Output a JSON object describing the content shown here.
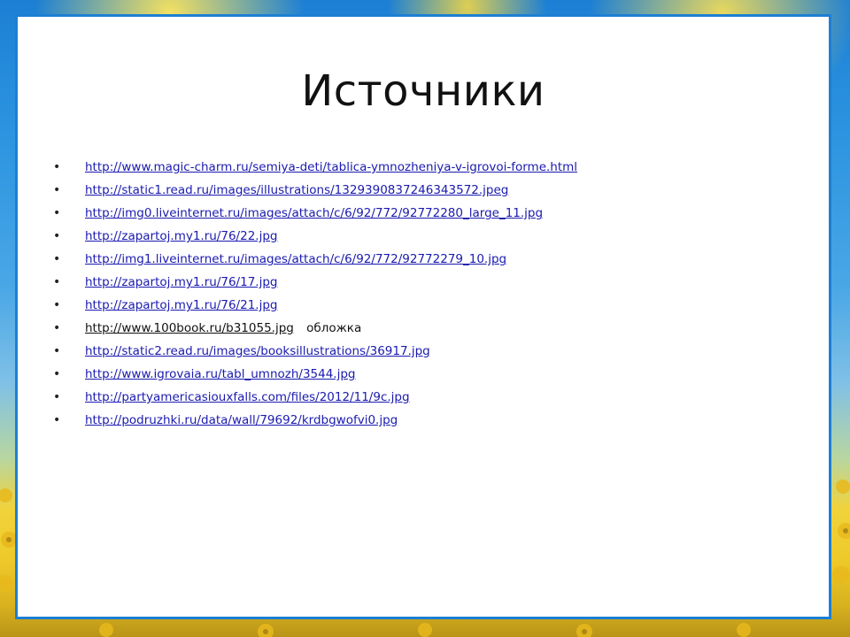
{
  "slide": {
    "title": "Источники",
    "sources": [
      {
        "url": "http://www.magic-charm.ru/semiya-deti/tablica-ymnozheniya-v-igrovoi-forme.html",
        "note": ""
      },
      {
        "url": "http://static1.read.ru/images/illustrations/1329390837246343572.jpeg",
        "note": ""
      },
      {
        "url": "http://img0.liveinternet.ru/images/attach/c/6/92/772/92772280_large_11.jpg",
        "note": ""
      },
      {
        "url": "http://zapartoj.my1.ru/76/22.jpg",
        "note": ""
      },
      {
        "url": "http://img1.liveinternet.ru/images/attach/c/6/92/772/92772279_10.jpg",
        "note": ""
      },
      {
        "url": "http://zapartoj.my1.ru/76/17.jpg",
        "note": ""
      },
      {
        "url": "http://zapartoj.my1.ru/76/21.jpg",
        "note": ""
      },
      {
        "url": "http://www.100book.ru/b31055.jpg",
        "note": "обложка"
      },
      {
        "url": "http://static2.read.ru/images/booksillustrations/36917.jpg",
        "note": ""
      },
      {
        "url": "http://www.igrovaia.ru/tabl_umnozh/3544.jpg",
        "note": ""
      },
      {
        "url": "http://partyamericasiouxfalls.com/files/2012/11/9c.jpg",
        "note": ""
      },
      {
        "url": "http://podruzhki.ru/data/wall/79692/krdbgwofvi0.jpg",
        "note": ""
      }
    ],
    "bullet_symbol": "•"
  },
  "colors": {
    "link": "#1a1ab0",
    "panel_border": "#1d7fd3",
    "text": "#111111"
  }
}
